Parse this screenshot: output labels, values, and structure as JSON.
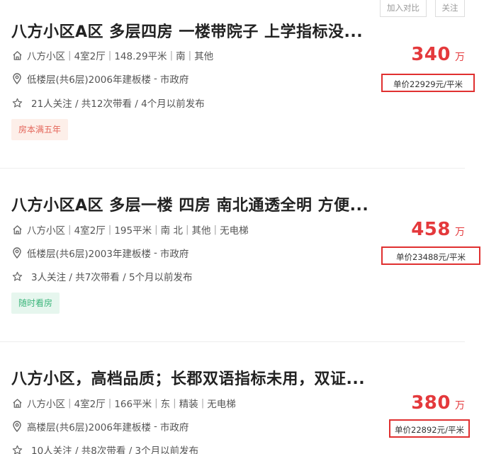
{
  "actions": {
    "compare_label": "加入对比",
    "follow_label": "关注"
  },
  "listings": [
    {
      "title": "八方小区A区 多层四房 一楼带院子 上学指标没...",
      "community": "八方小区",
      "layout": "4室2厅",
      "area": "148.29平米",
      "orientation": "南",
      "decoration": "其他",
      "elevator": "",
      "position": "低楼层(共6层)2006年建板楼",
      "district": "市政府",
      "follow_info": "21人关注 / 共12次带看 / 4个月以前发布",
      "tag": "房本满五年",
      "tag_color": "#e4665a",
      "total_price": "340",
      "price_unit": "万",
      "unit_price": "单价22929元/平米"
    },
    {
      "title": "八方小区A区 多层一楼 四房 南北通透全明 方便...",
      "community": "八方小区",
      "layout": "4室2厅",
      "area": "195平米",
      "orientation": "南 北",
      "decoration": "其他",
      "elevator": "无电梯",
      "position": "低楼层(共6层)2003年建板楼",
      "district": "市政府",
      "follow_info": "3人关注 / 共7次带看 / 5个月以前发布",
      "tag": "随时看房",
      "tag_color": "#3bb57b",
      "total_price": "458",
      "price_unit": "万",
      "unit_price": "单价23488元/平米"
    },
    {
      "title": "八方小区，高档品质；长郡双语指标未用，双证...",
      "community": "八方小区",
      "layout": "4室2厅",
      "area": "166平米",
      "orientation": "东",
      "decoration": "精装",
      "elevator": "无电梯",
      "position": "高楼层(共6层)2006年建板楼",
      "district": "市政府",
      "follow_info": "10人关注 / 共8次带看 / 3个月以前发布",
      "tag": "",
      "tag_color": "",
      "total_price": "380",
      "price_unit": "万",
      "unit_price": "单价22892元/平米"
    }
  ],
  "colors": {
    "price_red": "#e4393c",
    "highlight_border": "#e03030",
    "text_dark": "#222222",
    "text_muted": "#555555"
  },
  "icons": [
    "house-icon",
    "location-pin-icon",
    "star-icon"
  ]
}
